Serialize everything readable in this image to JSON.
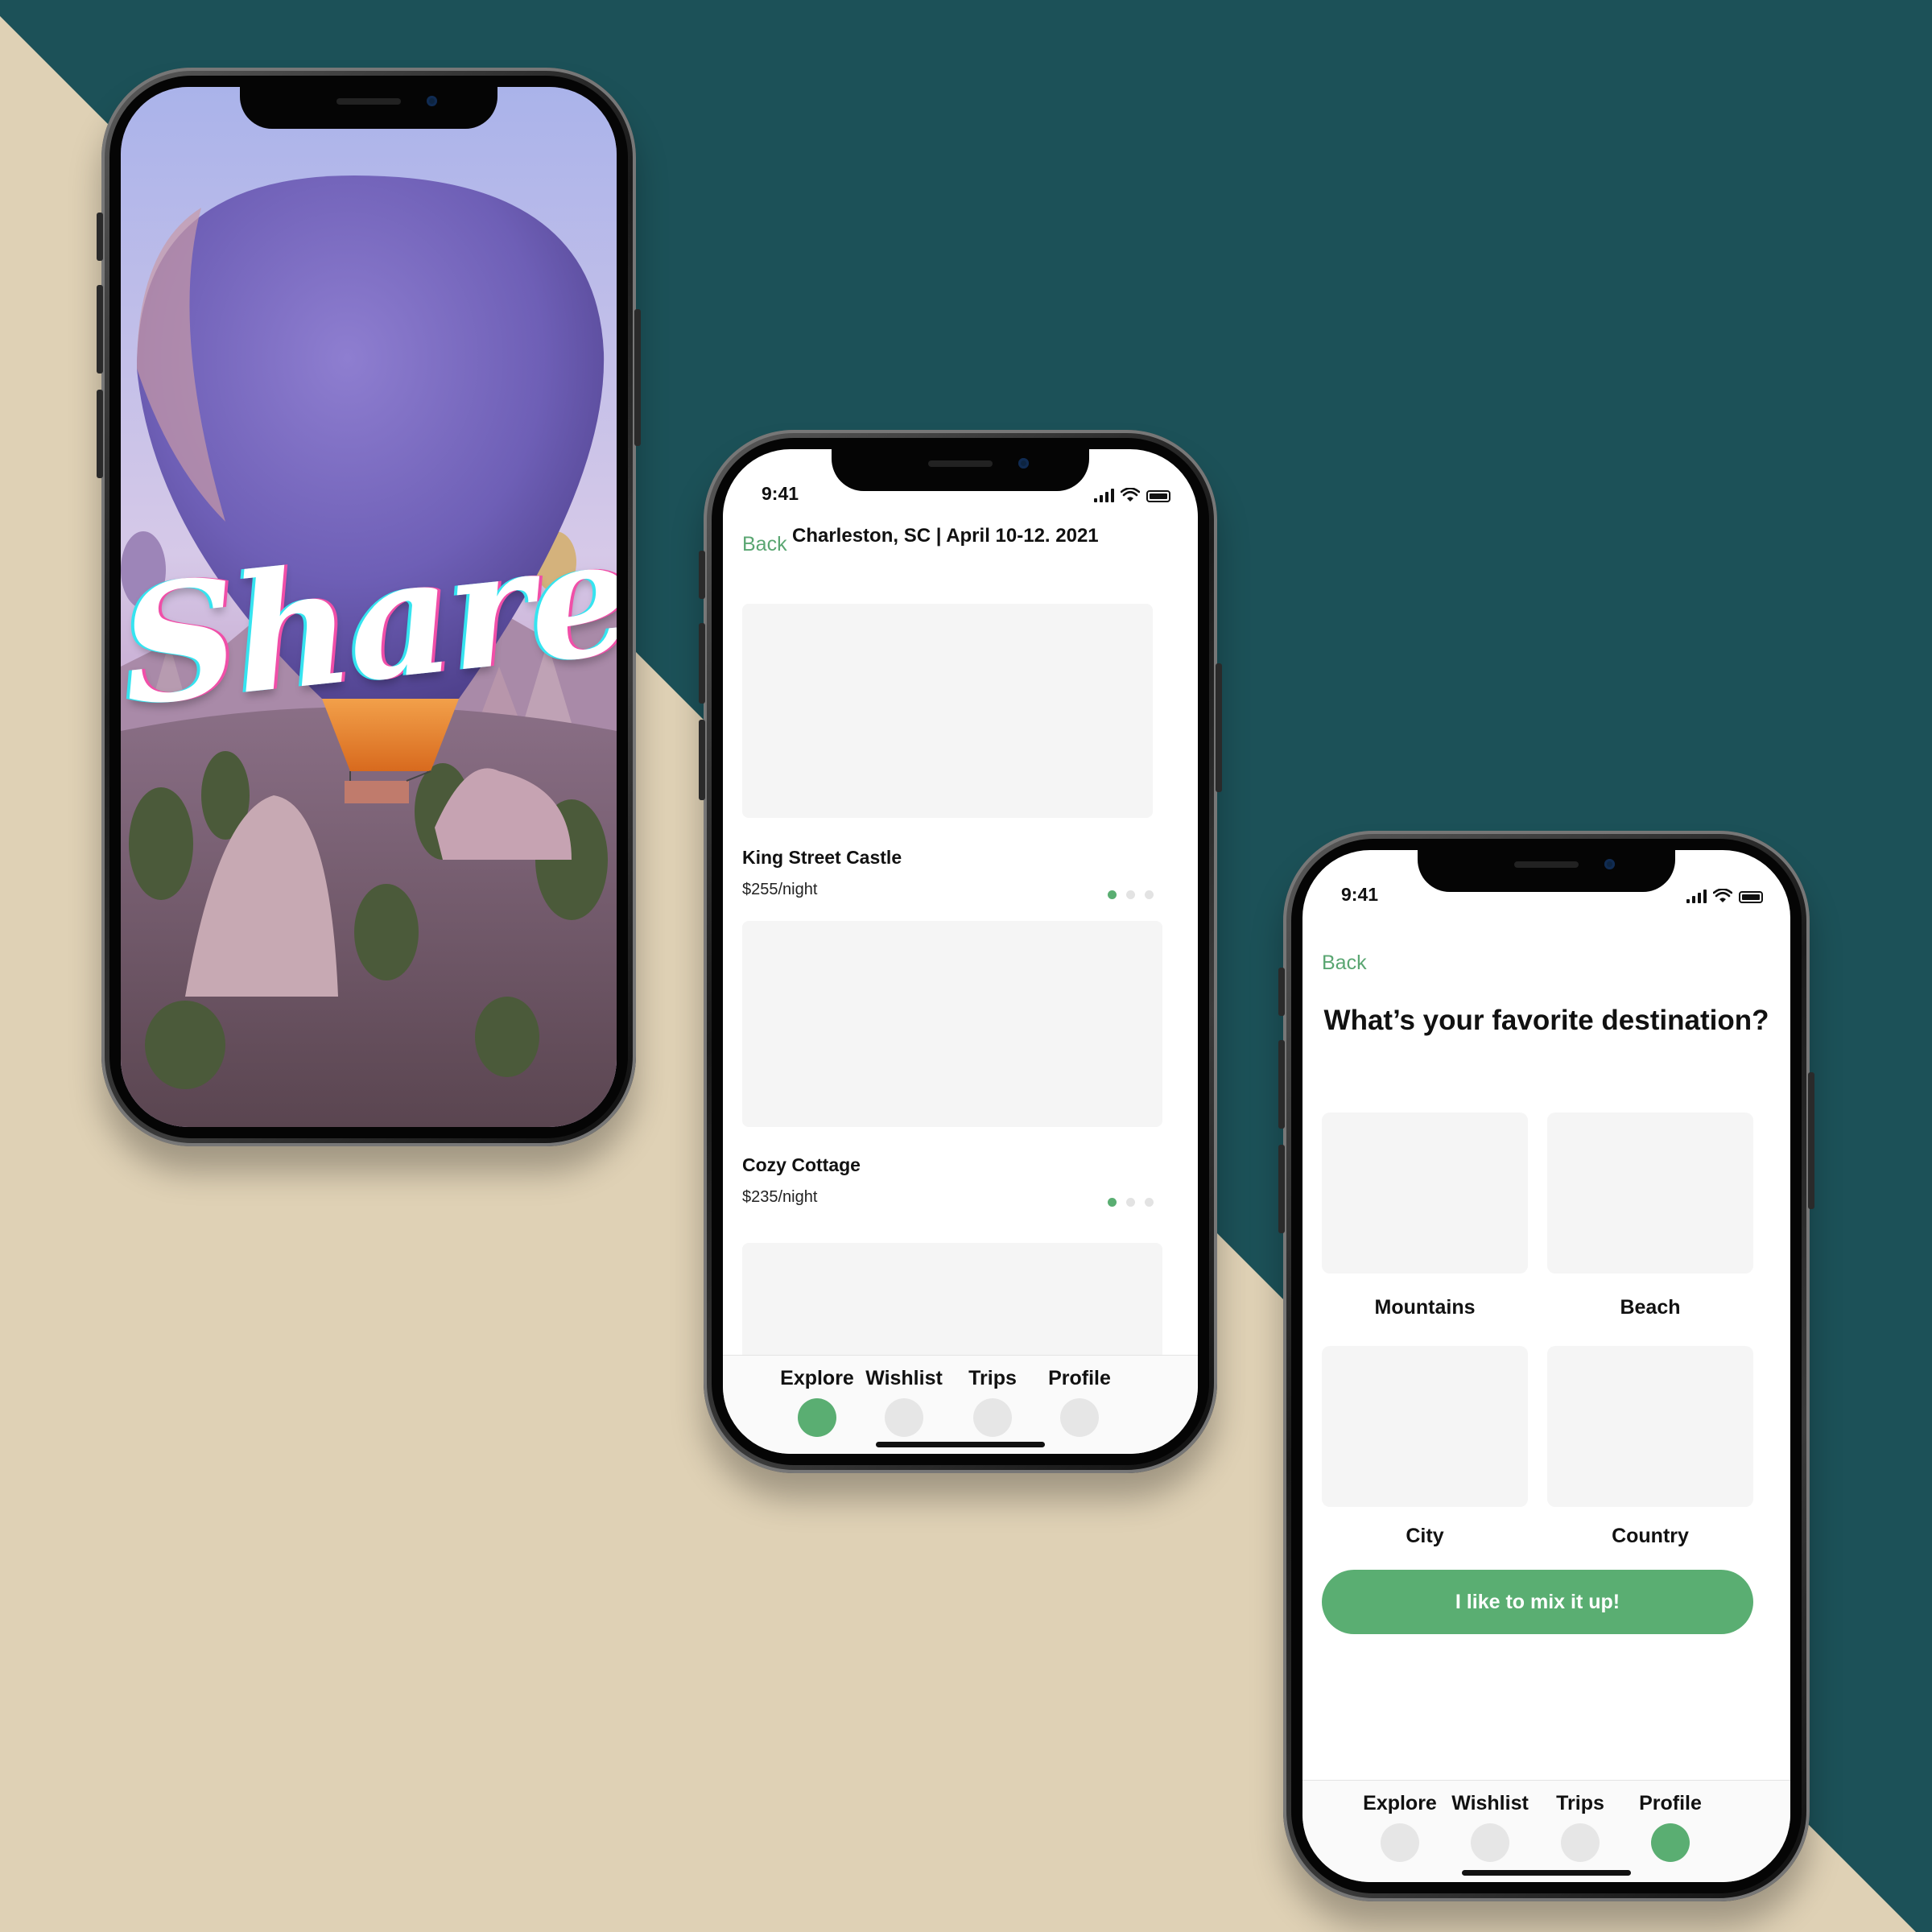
{
  "colors": {
    "teal_background": "#1c5158",
    "beige_background": "#dfd1b5",
    "accent_green": "#5aae72",
    "placeholder_gray": "#f5f5f5"
  },
  "splash": {
    "title": "Share"
  },
  "listing_screen": {
    "status_time": "9:41",
    "back_label": "Back",
    "header_title": "Charleston, SC | April 10-12. 2021",
    "listings": [
      {
        "name": "King Street Castle",
        "price": "$255/night",
        "active_image": 0,
        "image_count": 3
      },
      {
        "name": "Cozy Cottage",
        "price": "$235/night",
        "active_image": 0,
        "image_count": 3
      }
    ],
    "tabs": [
      {
        "label": "Explore",
        "active": true,
        "icon": "tab-dot-icon"
      },
      {
        "label": "Wishlist",
        "active": false,
        "icon": "tab-dot-icon"
      },
      {
        "label": "Trips",
        "active": false,
        "icon": "tab-dot-icon"
      },
      {
        "label": "Profile",
        "active": false,
        "icon": "tab-dot-icon"
      }
    ]
  },
  "destination_screen": {
    "status_time": "9:41",
    "back_label": "Back",
    "question": "What’s your favorite destination?",
    "options": [
      "Mountains",
      "Beach",
      "City",
      "Country"
    ],
    "cta_label": "I like to mix it up!",
    "tabs": [
      {
        "label": "Explore",
        "active": false,
        "icon": "tab-dot-icon"
      },
      {
        "label": "Wishlist",
        "active": false,
        "icon": "tab-dot-icon"
      },
      {
        "label": "Trips",
        "active": false,
        "icon": "tab-dot-icon"
      },
      {
        "label": "Profile",
        "active": true,
        "icon": "tab-dot-icon"
      }
    ]
  }
}
